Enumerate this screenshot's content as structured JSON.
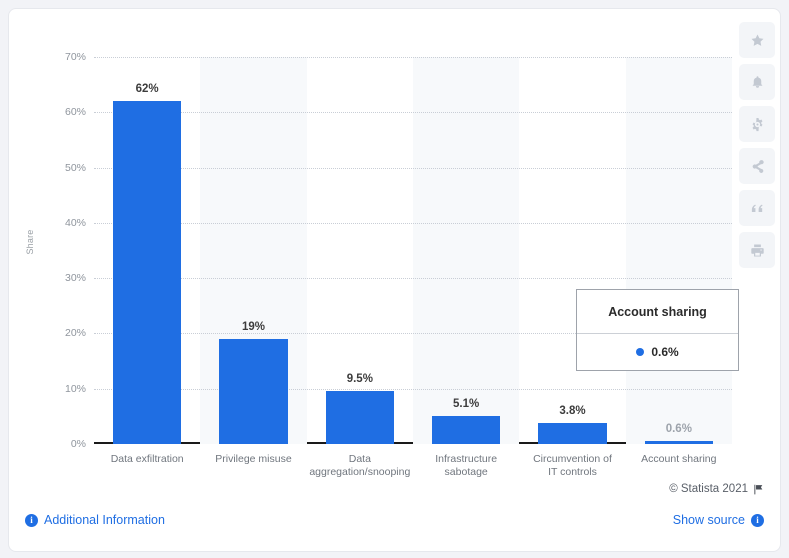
{
  "chart_data": {
    "type": "bar",
    "title": "",
    "subtitle": "",
    "xlabel": "",
    "ylabel": "Share",
    "ylim": [
      0,
      70
    ],
    "ytick_labels": [
      "0%",
      "10%",
      "20%",
      "30%",
      "40%",
      "50%",
      "60%",
      "70%"
    ],
    "ytick_values": [
      0,
      10,
      20,
      30,
      40,
      50,
      60,
      70
    ],
    "grid": true,
    "legend_position": "none",
    "bar_color": "#1f6ee3",
    "categories": [
      "Data exfiltration",
      "Privilege misuse",
      "Data aggregation/snooping",
      "Infrastructure sabotage",
      "Circumvention of IT controls",
      "Account sharing"
    ],
    "category_lines": [
      [
        "Data exfiltration"
      ],
      [
        "Privilege misuse"
      ],
      [
        "Data",
        "aggregation/snooping"
      ],
      [
        "Infrastructure",
        "sabotage"
      ],
      [
        "Circumvention of",
        "IT controls"
      ],
      [
        "Account sharing"
      ]
    ],
    "values": [
      62,
      19,
      9.5,
      5.1,
      3.8,
      0.6
    ],
    "data_labels": [
      "62%",
      "19%",
      "9.5%",
      "5.1%",
      "3.8%",
      "0.6%"
    ],
    "hovered_index": 5
  },
  "tooltip": {
    "title": "Account sharing",
    "value": "0.6%",
    "dot_color": "#1f6ee3"
  },
  "footer": {
    "copyright": "© Statista 2021",
    "flag_icon": "flag-icon",
    "additional_information": "Additional Information",
    "additional_information_icon": "info-icon",
    "show_source": "Show source",
    "show_source_icon": "info-icon"
  },
  "rail": {
    "items": [
      {
        "icon": "star-icon",
        "label": "Favorite"
      },
      {
        "icon": "bell-icon",
        "label": "Notify"
      },
      {
        "icon": "gear-icon",
        "label": "Settings"
      },
      {
        "icon": "share-icon",
        "label": "Share"
      },
      {
        "icon": "quote-icon",
        "label": "Cite"
      },
      {
        "icon": "print-icon",
        "label": "Print"
      }
    ]
  },
  "colors": {
    "accent": "#1f6ee3",
    "page_bg": "#f2f3f7",
    "card_bg": "#ffffff",
    "band": "#f7f9fb",
    "grid": "#c9ced6",
    "axis": "#1a1a1a"
  }
}
